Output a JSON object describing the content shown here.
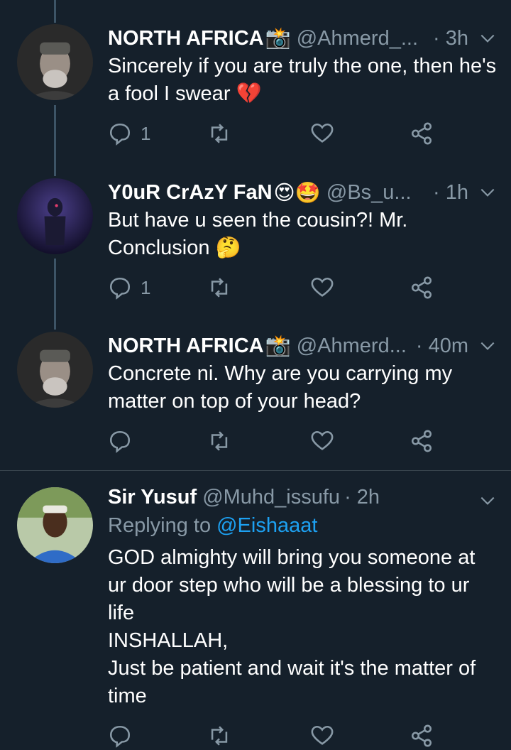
{
  "tweets": [
    {
      "name": "NORTH AFRICA",
      "name_emoji": "📸",
      "handle": "@Ahmerd_...",
      "time": "· 3h",
      "text": "Sincerely if you are truly the one, then he's a fool I swear 💔",
      "reply_count": "1"
    },
    {
      "name": "Y0uR CrAzY FaN",
      "name_emoji": "😍🤩",
      "handle": "@Bs_u...",
      "time": "· 1h",
      "text": "But have u seen the cousin?! Mr. Conclusion 🤔",
      "reply_count": "1"
    },
    {
      "name": "NORTH AFRICA",
      "name_emoji": "📸",
      "handle": "@Ahmerd...",
      "time": "· 40m",
      "text": "Concrete ni. Why are you carrying my matter on top of your head?",
      "reply_count": ""
    },
    {
      "name": "Sir Yusuf",
      "name_emoji": "",
      "handle": "@Muhd_issufu",
      "time": "· 2h",
      "replying_label": "Replying to",
      "replying_handle": "@Eishaaat",
      "text": "GOD almighty will bring you someone at ur door step who will be a blessing to ur life\nINSHALLAH,\nJust be patient and wait it's the matter of time",
      "reply_count": ""
    }
  ],
  "icons": {
    "reply": "reply-icon",
    "retweet": "retweet-icon",
    "like": "heart-icon",
    "share": "share-icon",
    "caret": "chevron-down-icon"
  },
  "colors": {
    "background": "#15202b",
    "secondary_text": "#8899a6",
    "link": "#1da1f2",
    "divider": "#38444d"
  }
}
